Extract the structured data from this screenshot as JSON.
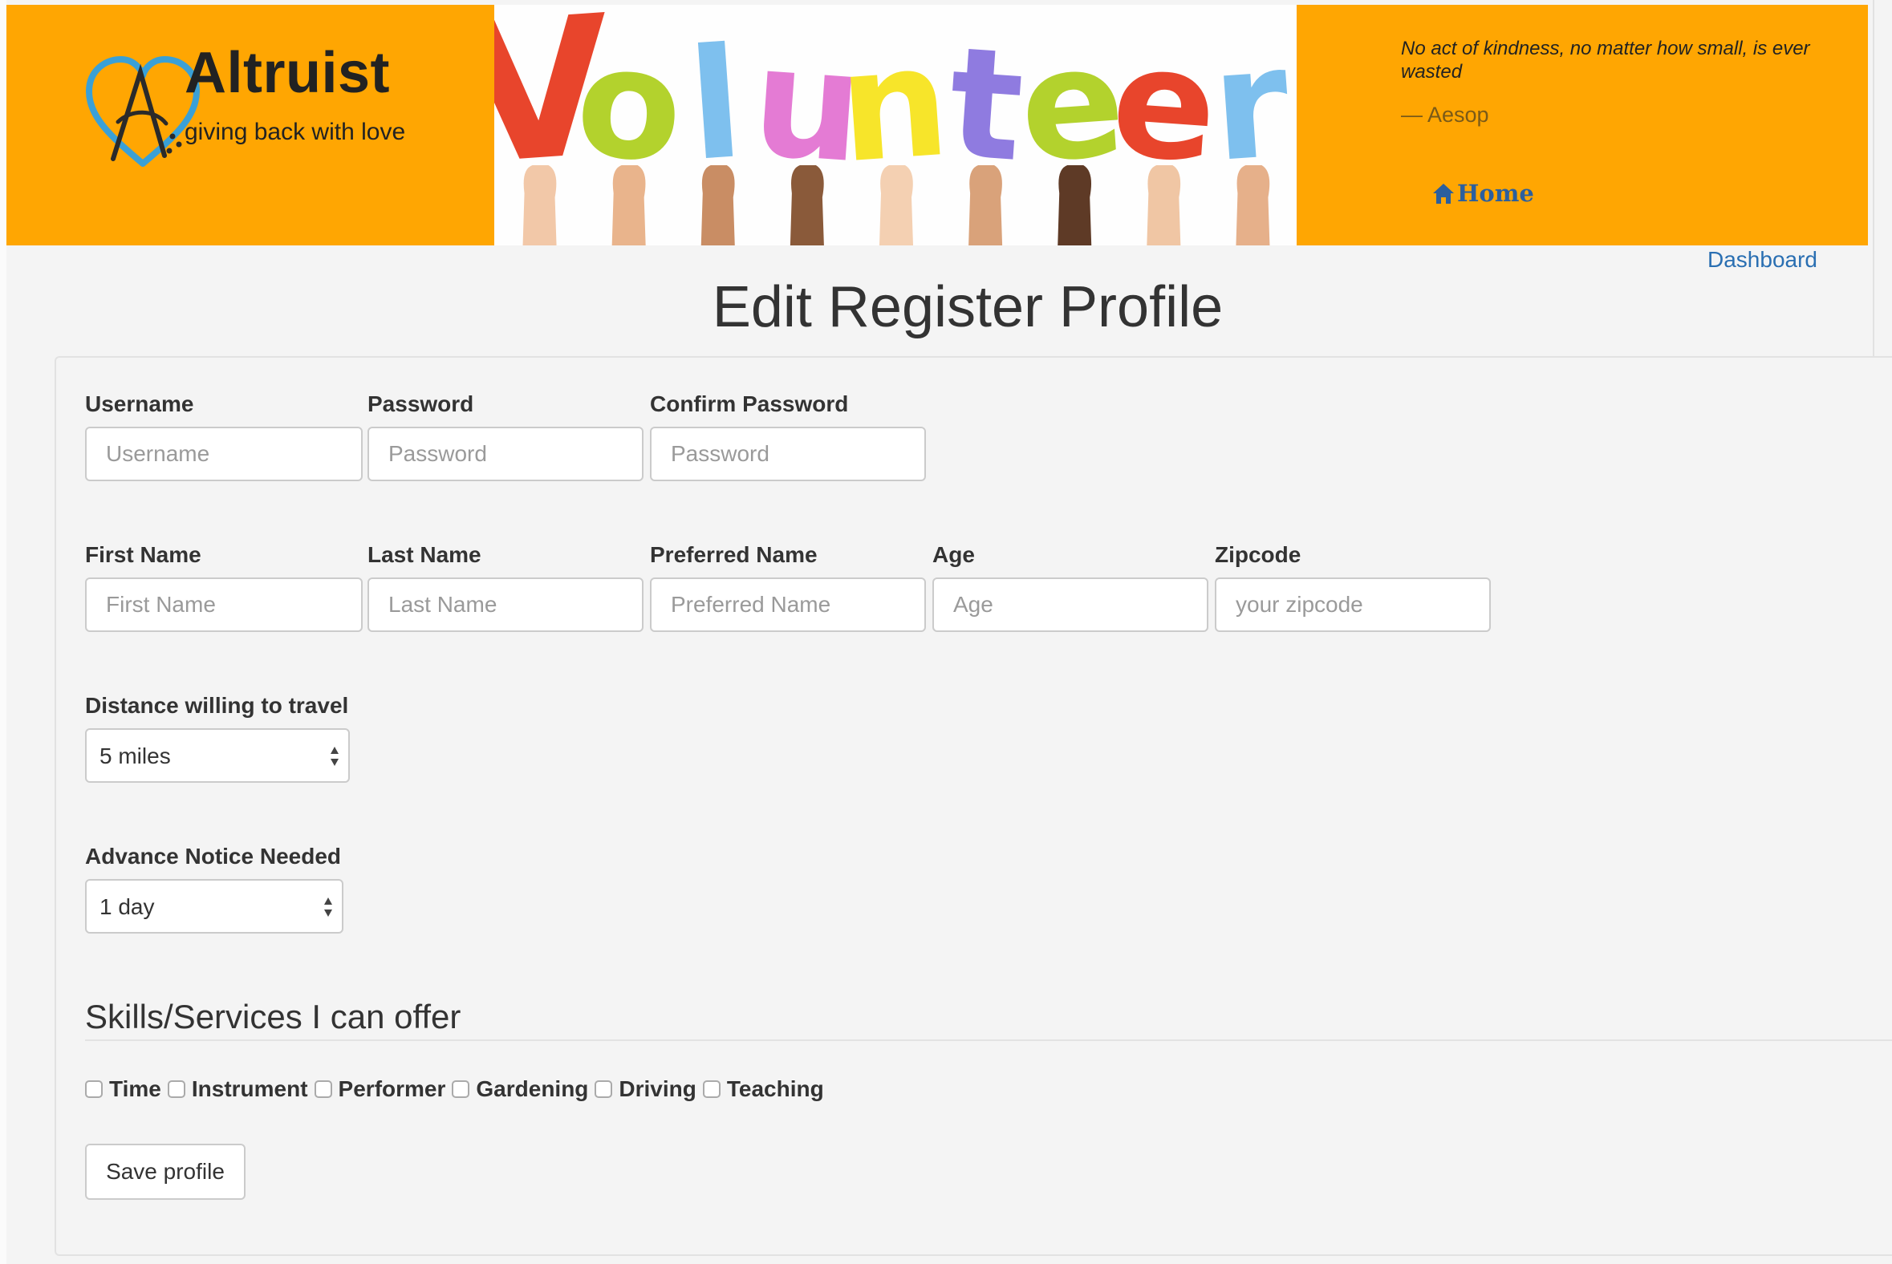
{
  "brand": {
    "name": "Altruist",
    "tagline": "giving back with love",
    "banner_word": "Volunteer"
  },
  "quote": {
    "text": "No act of kindness, no matter how small, is ever wasted",
    "author": "— Aesop"
  },
  "nav": {
    "home_label": "Home",
    "dashboard_label": "Dashboard"
  },
  "page": {
    "title": "Edit Register Profile"
  },
  "form": {
    "username": {
      "label": "Username",
      "placeholder": "Username"
    },
    "password": {
      "label": "Password",
      "placeholder": "Password"
    },
    "confirm_password": {
      "label": "Confirm Password",
      "placeholder": "Password"
    },
    "first_name": {
      "label": "First Name",
      "placeholder": "First Name"
    },
    "last_name": {
      "label": "Last Name",
      "placeholder": "Last Name"
    },
    "preferred_name": {
      "label": "Preferred Name",
      "placeholder": "Preferred Name"
    },
    "age": {
      "label": "Age",
      "placeholder": "Age"
    },
    "zipcode": {
      "label": "Zipcode",
      "placeholder": "your zipcode"
    },
    "distance": {
      "label": "Distance willing to travel",
      "selected": "5 miles"
    },
    "notice": {
      "label": "Advance Notice Needed",
      "selected": "1 day"
    }
  },
  "skills": {
    "heading": "Skills/Services I can offer",
    "items": [
      {
        "label": "Time",
        "checked": false
      },
      {
        "label": "Instrument",
        "checked": false
      },
      {
        "label": "Performer",
        "checked": false
      },
      {
        "label": "Gardening",
        "checked": false
      },
      {
        "label": "Driving",
        "checked": false
      },
      {
        "label": "Teaching",
        "checked": false
      }
    ]
  },
  "actions": {
    "save_label": "Save profile"
  },
  "colors": {
    "header_orange": "#ffa602",
    "link_blue": "#2a6fb2",
    "logo_blue": "#3aa0d6",
    "banner_letters": [
      "#e8452c",
      "#b3d22d",
      "#7ec0ee",
      "#e47bd4",
      "#f7e52a",
      "#8f7be0",
      "#b3d22d",
      "#e8452c",
      "#7ec0ee"
    ]
  },
  "icons": {
    "logo": "heart-letter-a-logo",
    "home": "home-icon",
    "select": "up-down-arrows-icon"
  }
}
